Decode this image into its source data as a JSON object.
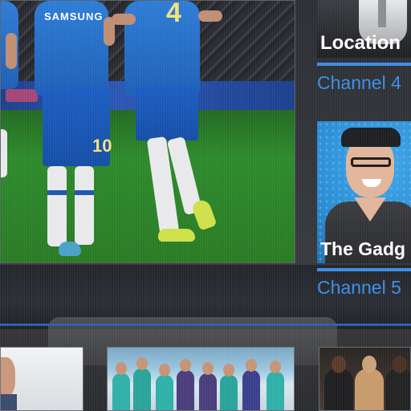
{
  "main_video": {
    "players": [
      {
        "sponsor": "",
        "number": ""
      },
      {
        "sponsor": "SAMSUNG",
        "number": "10"
      },
      {
        "sponsor": "",
        "number": "4"
      }
    ]
  },
  "side_promos": [
    {
      "title": "Location",
      "channel": "Channel 4"
    },
    {
      "title": "The Gadg",
      "channel": "Channel 5"
    }
  ],
  "bottom_row": [
    {
      "name": "presenter-thumbnail"
    },
    {
      "name": "medical-staff-thumbnail"
    },
    {
      "name": "celebrity-panel-thumbnail"
    }
  ],
  "colors": {
    "accent": "#3d8ee6",
    "pitch": "#2c8a2a",
    "kit": "#2d7cd6"
  }
}
